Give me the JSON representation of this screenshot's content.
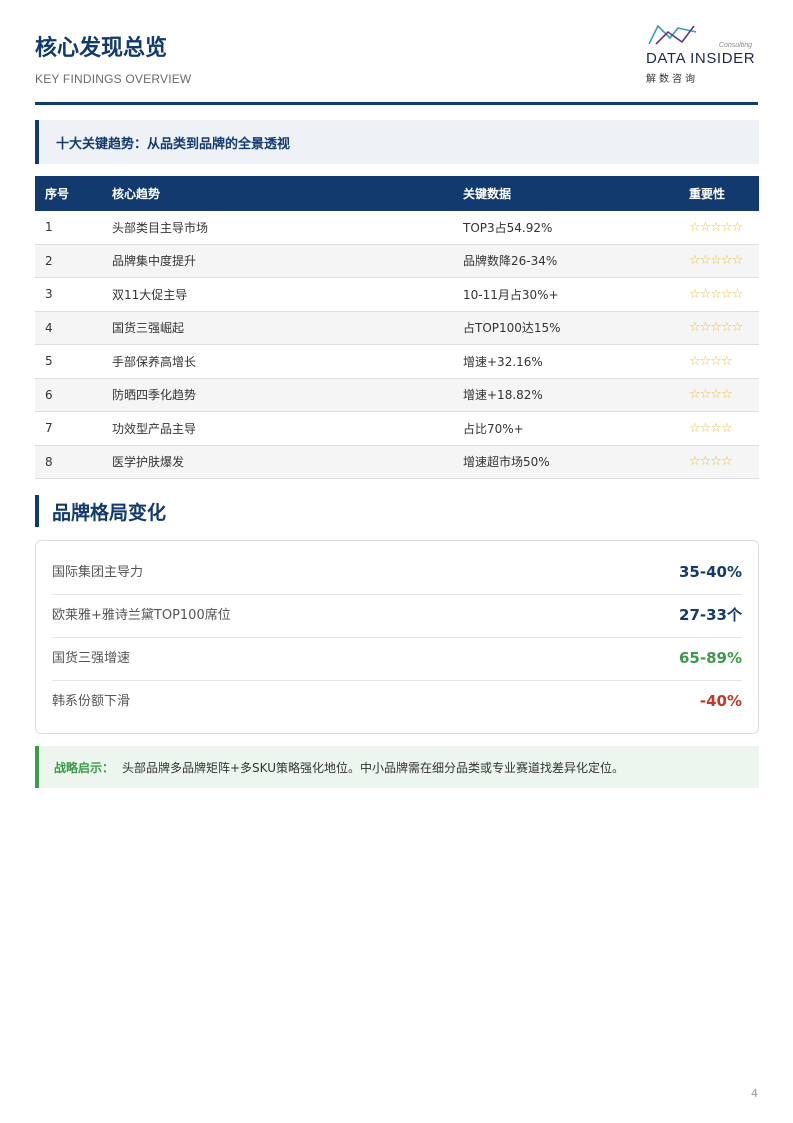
{
  "header": {
    "title": "核心发现总览",
    "subtitle": "KEY FINDINGS OVERVIEW",
    "logo": {
      "consulting": "Consulting",
      "name": "DATA INSIDER",
      "cn": "解数咨询"
    }
  },
  "trend_heading": "十大关键趋势：从品类到品牌的全景透视",
  "table": {
    "headers": [
      "序号",
      "核心趋势",
      "关键数据",
      "重要性"
    ],
    "rows": [
      {
        "no": "1",
        "trend": "头部类目主导市场",
        "data": "TOP3占54.92%",
        "stars": "☆☆☆☆☆",
        "rating": 5
      },
      {
        "no": "2",
        "trend": "品牌集中度提升",
        "data": "品牌数降26-34%",
        "stars": "☆☆☆☆☆",
        "rating": 5
      },
      {
        "no": "3",
        "trend": "双11大促主导",
        "data": "10-11月占30%+",
        "stars": "☆☆☆☆☆",
        "rating": 5
      },
      {
        "no": "4",
        "trend": "国货三强崛起",
        "data": "占TOP100达15%",
        "stars": "☆☆☆☆☆",
        "rating": 5
      },
      {
        "no": "5",
        "trend": "手部保养高增长",
        "data": "增速+32.16%",
        "stars": "☆☆☆☆",
        "rating": 4
      },
      {
        "no": "6",
        "trend": "防晒四季化趋势",
        "data": "增速+18.82%",
        "stars": "☆☆☆☆",
        "rating": 4
      },
      {
        "no": "7",
        "trend": "功效型产品主导",
        "data": "占比70%+",
        "stars": "☆☆☆☆",
        "rating": 4
      },
      {
        "no": "8",
        "trend": "医学护肤爆发",
        "data": "增速超市场50%",
        "stars": "☆☆☆☆",
        "rating": 4
      }
    ]
  },
  "brand_section": {
    "title": "品牌格局变化",
    "items": [
      {
        "label": "国际集团主导力",
        "value": "35-40%",
        "color": "#123a6e"
      },
      {
        "label": "欧莱雅+雅诗兰黛TOP100席位",
        "value": "27-33个",
        "color": "#123a6e"
      },
      {
        "label": "国货三强增速",
        "value": "65-89%",
        "color": "#3e9a4b"
      },
      {
        "label": "韩系份额下滑",
        "value": "-40%",
        "color": "#c0392b"
      }
    ]
  },
  "strategy": {
    "label": "战略启示：",
    "text": "头部品牌多品牌矩阵+多SKU策略强化地位。中小品牌需在细分品类或专业赛道找差异化定位。"
  },
  "page_number": "4",
  "colors": {
    "navy": "#123a6e",
    "green": "#3e9a4b",
    "red": "#c0392b",
    "star": "#e8bd3a"
  }
}
